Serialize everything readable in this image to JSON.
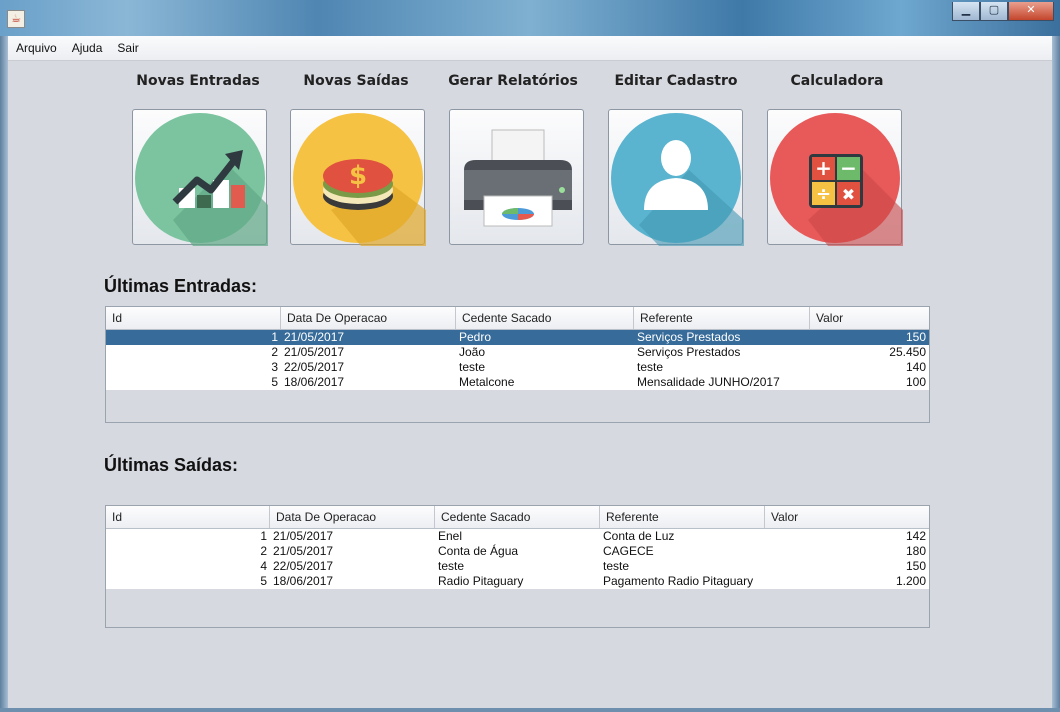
{
  "menu": [
    "Arquivo",
    "Ajuda",
    "Sair"
  ],
  "actions": [
    {
      "label": "Novas Entradas",
      "icon": "chart-growth-icon",
      "color": "#7cc4a0"
    },
    {
      "label": "Novas Saídas",
      "icon": "coins-icon",
      "color": "#f6c244"
    },
    {
      "label": "Gerar Relatórios",
      "icon": "printer-icon",
      "color": "#d8dadd"
    },
    {
      "label": "Editar Cadastro",
      "icon": "user-icon",
      "color": "#5ab4cf"
    },
    {
      "label": "Calculadora",
      "icon": "calculator-icon",
      "color": "#e85a5a"
    }
  ],
  "entradas": {
    "title": "Últimas Entradas:",
    "columns": [
      "Id",
      "Data De Operacao",
      "Cedente Sacado",
      "Referente",
      "Valor"
    ],
    "rows": [
      {
        "id": "1",
        "data": "21/05/2017",
        "cedente": "Pedro",
        "referente": "Serviços Prestados",
        "valor": "150"
      },
      {
        "id": "2",
        "data": "21/05/2017",
        "cedente": "João",
        "referente": "Serviços Prestados",
        "valor": "25.450"
      },
      {
        "id": "3",
        "data": "22/05/2017",
        "cedente": "teste",
        "referente": "teste",
        "valor": "140"
      },
      {
        "id": "5",
        "data": "18/06/2017",
        "cedente": "Metalcone",
        "referente": "Mensalidade JUNHO/2017",
        "valor": "100"
      }
    ],
    "selected_row": 0
  },
  "saidas": {
    "title": "Últimas Saídas:",
    "columns": [
      "Id",
      "Data De Operacao",
      "Cedente Sacado",
      "Referente",
      "Valor"
    ],
    "rows": [
      {
        "id": "1",
        "data": "21/05/2017",
        "cedente": "Enel",
        "referente": "Conta de Luz",
        "valor": "142"
      },
      {
        "id": "2",
        "data": "21/05/2017",
        "cedente": "Conta de Água",
        "referente": "CAGECE",
        "valor": "180"
      },
      {
        "id": "4",
        "data": "22/05/2017",
        "cedente": "teste",
        "referente": "teste",
        "valor": "150"
      },
      {
        "id": "5",
        "data": "18/06/2017",
        "cedente": "Radio Pitaguary",
        "referente": "Pagamento Radio Pitaguary",
        "valor": "1.200"
      }
    ]
  }
}
